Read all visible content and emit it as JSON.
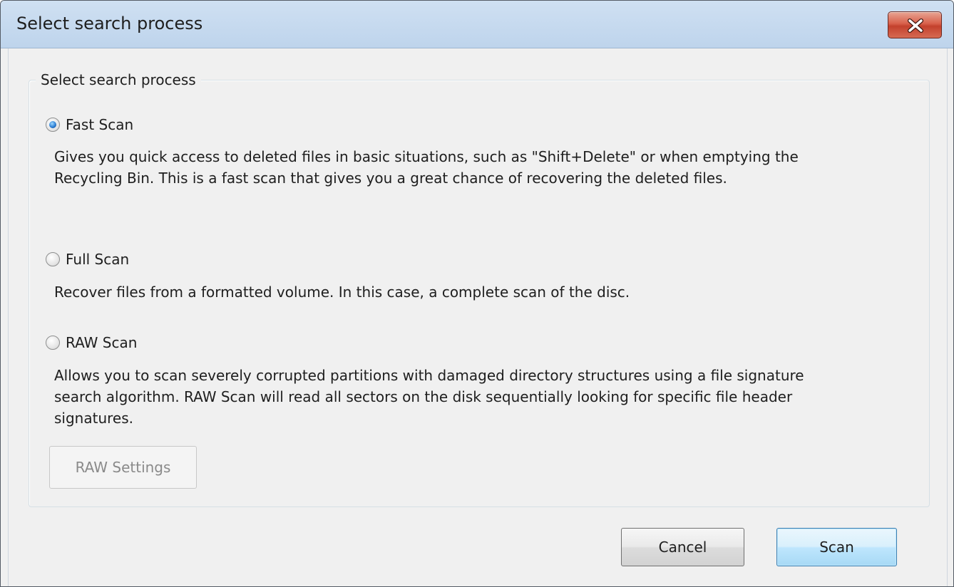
{
  "window": {
    "title": "Select search process"
  },
  "group": {
    "label": "Select search process"
  },
  "options": [
    {
      "label": "Fast Scan",
      "checked": true,
      "description": "Gives you quick access to deleted files in basic situations, such as \"Shift+Delete\" or when emptying the Recycling Bin. This is a fast scan that gives you a great chance of recovering the deleted files."
    },
    {
      "label": "Full Scan",
      "checked": false,
      "description": "Recover files from a formatted volume. In this case, a complete scan of the disc."
    },
    {
      "label": "RAW Scan",
      "checked": false,
      "description": "Allows you to scan severely corrupted partitions with damaged directory structures using a file signature search algorithm. RAW Scan will read all sectors on the disk sequentially looking for specific file header signatures."
    }
  ],
  "buttons": {
    "raw_settings": "RAW Settings",
    "cancel": "Cancel",
    "scan": "Scan"
  },
  "colors": {
    "close_button": "#c3412d",
    "titlebar": "#bed4ec",
    "selected_radio": "#2c7fd4"
  }
}
